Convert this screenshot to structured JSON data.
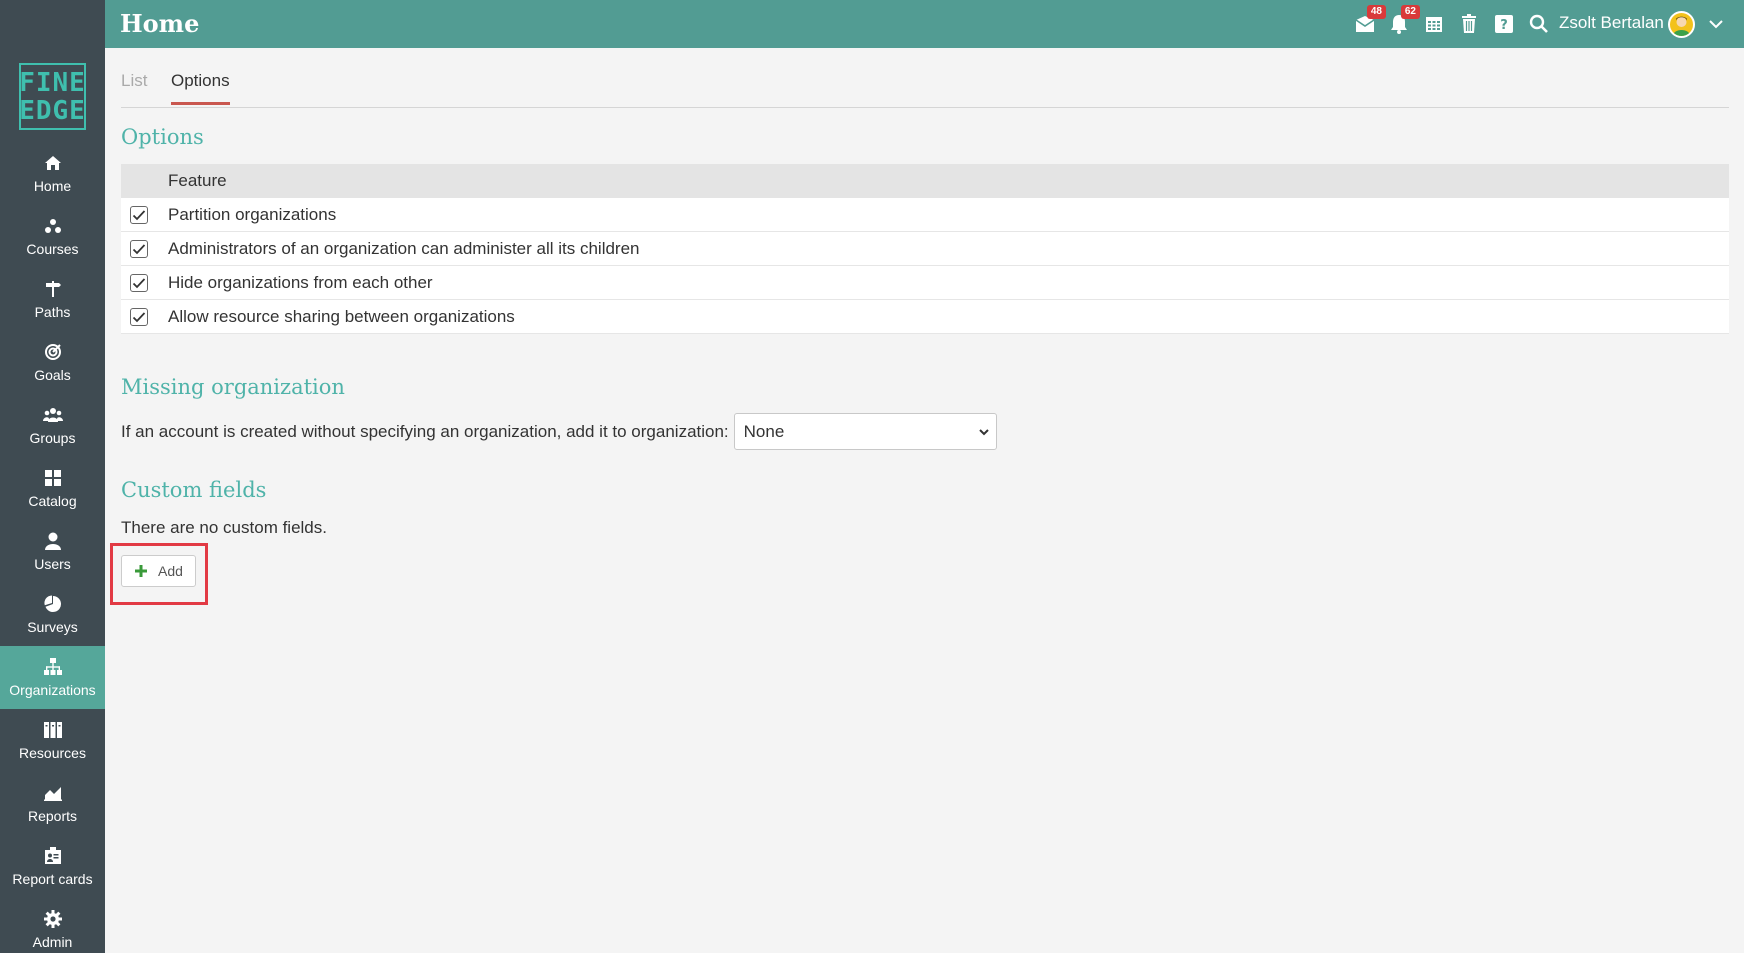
{
  "header": {
    "title": "Home",
    "messages_badge": "48",
    "notifications_badge": "62",
    "username": "Zsolt Bertalan"
  },
  "logo": {
    "line1": "FINE",
    "line2": "EDGE"
  },
  "sidebar": {
    "items": [
      {
        "label": "Home",
        "icon": "home-icon"
      },
      {
        "label": "Courses",
        "icon": "courses-icon"
      },
      {
        "label": "Paths",
        "icon": "paths-icon"
      },
      {
        "label": "Goals",
        "icon": "goals-icon"
      },
      {
        "label": "Groups",
        "icon": "groups-icon"
      },
      {
        "label": "Catalog",
        "icon": "catalog-icon"
      },
      {
        "label": "Users",
        "icon": "users-icon"
      },
      {
        "label": "Surveys",
        "icon": "surveys-icon"
      },
      {
        "label": "Organizations",
        "icon": "organizations-icon",
        "active": true
      },
      {
        "label": "Resources",
        "icon": "resources-icon"
      },
      {
        "label": "Reports",
        "icon": "reports-icon"
      },
      {
        "label": "Report cards",
        "icon": "report-cards-icon"
      },
      {
        "label": "Admin",
        "icon": "admin-icon"
      }
    ]
  },
  "tabs": {
    "list": "List",
    "options": "Options"
  },
  "options": {
    "title": "Options",
    "header": "Feature",
    "rows": [
      {
        "label": "Partition organizations",
        "checked": true
      },
      {
        "label": "Administrators of an organization can administer all its children",
        "checked": true
      },
      {
        "label": "Hide organizations from each other",
        "checked": true
      },
      {
        "label": "Allow resource sharing between organizations",
        "checked": true
      }
    ]
  },
  "missing": {
    "title": "Missing organization",
    "label": "If an account is created without specifying an organization, add it to organization:",
    "selected": "None"
  },
  "custom": {
    "title": "Custom fields",
    "empty_text": "There are no custom fields.",
    "add_label": "Add"
  },
  "colors": {
    "topbar": "#529c93",
    "sidebar": "#3f4b52",
    "active_nav": "#55a79a",
    "section_title": "#4fb3a9",
    "tab_underline": "#c9574f",
    "highlight": "#e23a44",
    "badge": "#d93a3a"
  }
}
